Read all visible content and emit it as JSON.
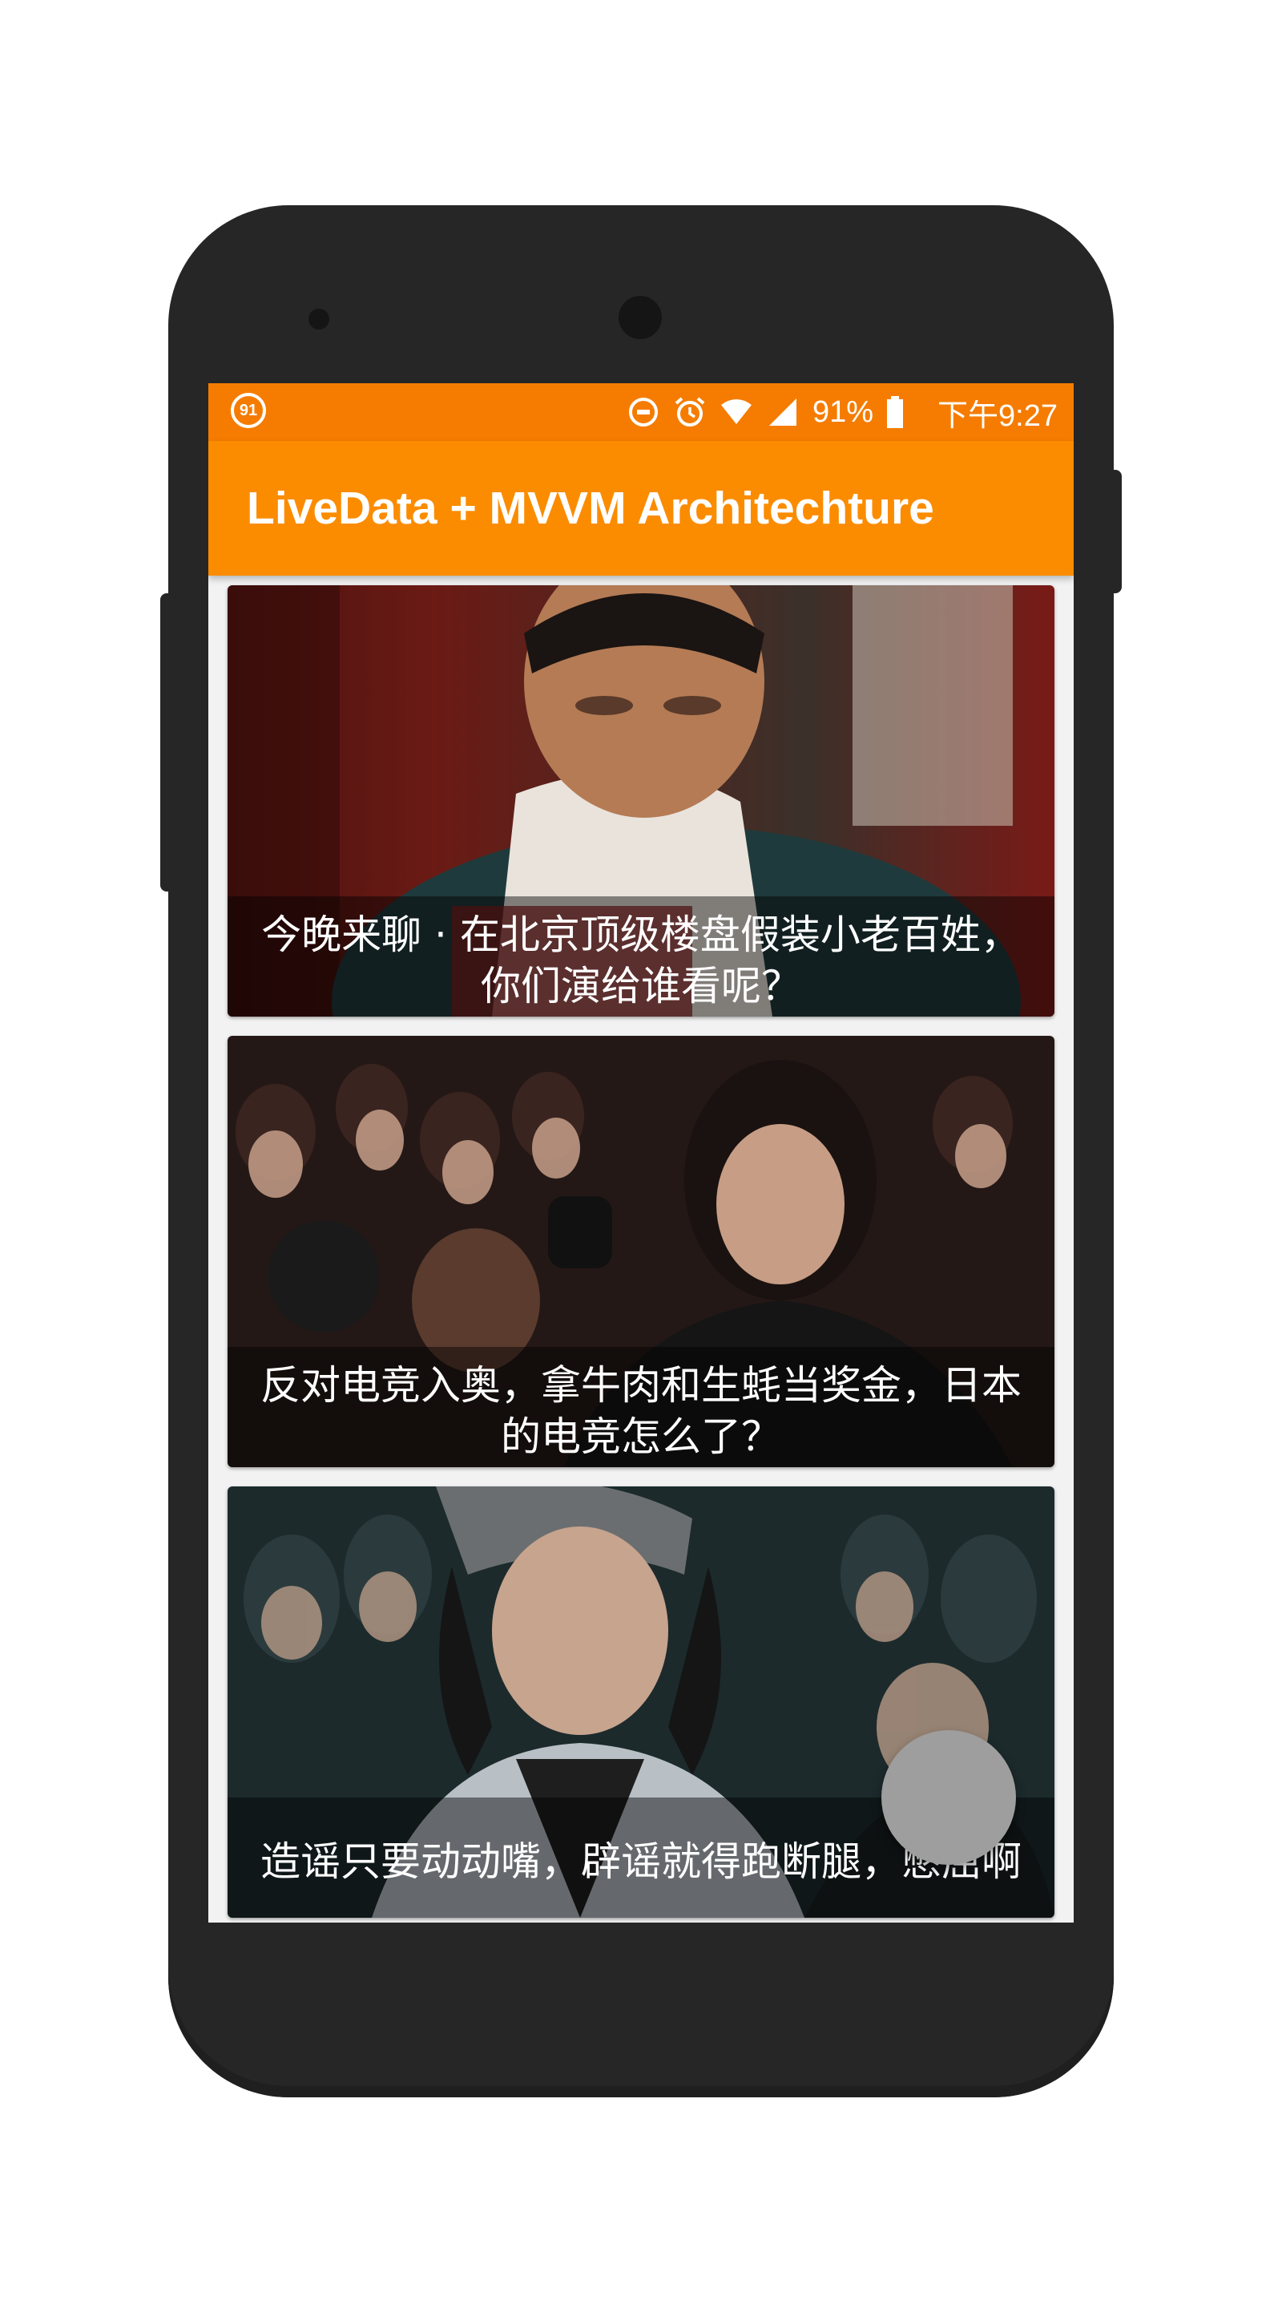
{
  "status_bar": {
    "left_badge": "91",
    "battery": "91%",
    "time": "下午9:27",
    "icons": [
      "data-saver-icon",
      "alarm-icon",
      "wifi-icon",
      "signal-icon",
      "battery-icon"
    ]
  },
  "toolbar": {
    "title": "LiveData + MVVM Architechture"
  },
  "feed": [
    {
      "title": "今晚来聊 · 在北京顶级楼盘假装小老百姓，你们演给谁看呢？"
    },
    {
      "title": "反对电竞入奥，拿牛肉和生蚝当奖金，日本的电竞怎么了？"
    },
    {
      "title": "造谣只要动动嘴，辟谣就得跑断腿，憋屈啊"
    }
  ],
  "colors": {
    "status_bar": "#f57c00",
    "toolbar": "#fb8c00",
    "fab": "#9e9e9e",
    "phone_body": "#262626"
  }
}
